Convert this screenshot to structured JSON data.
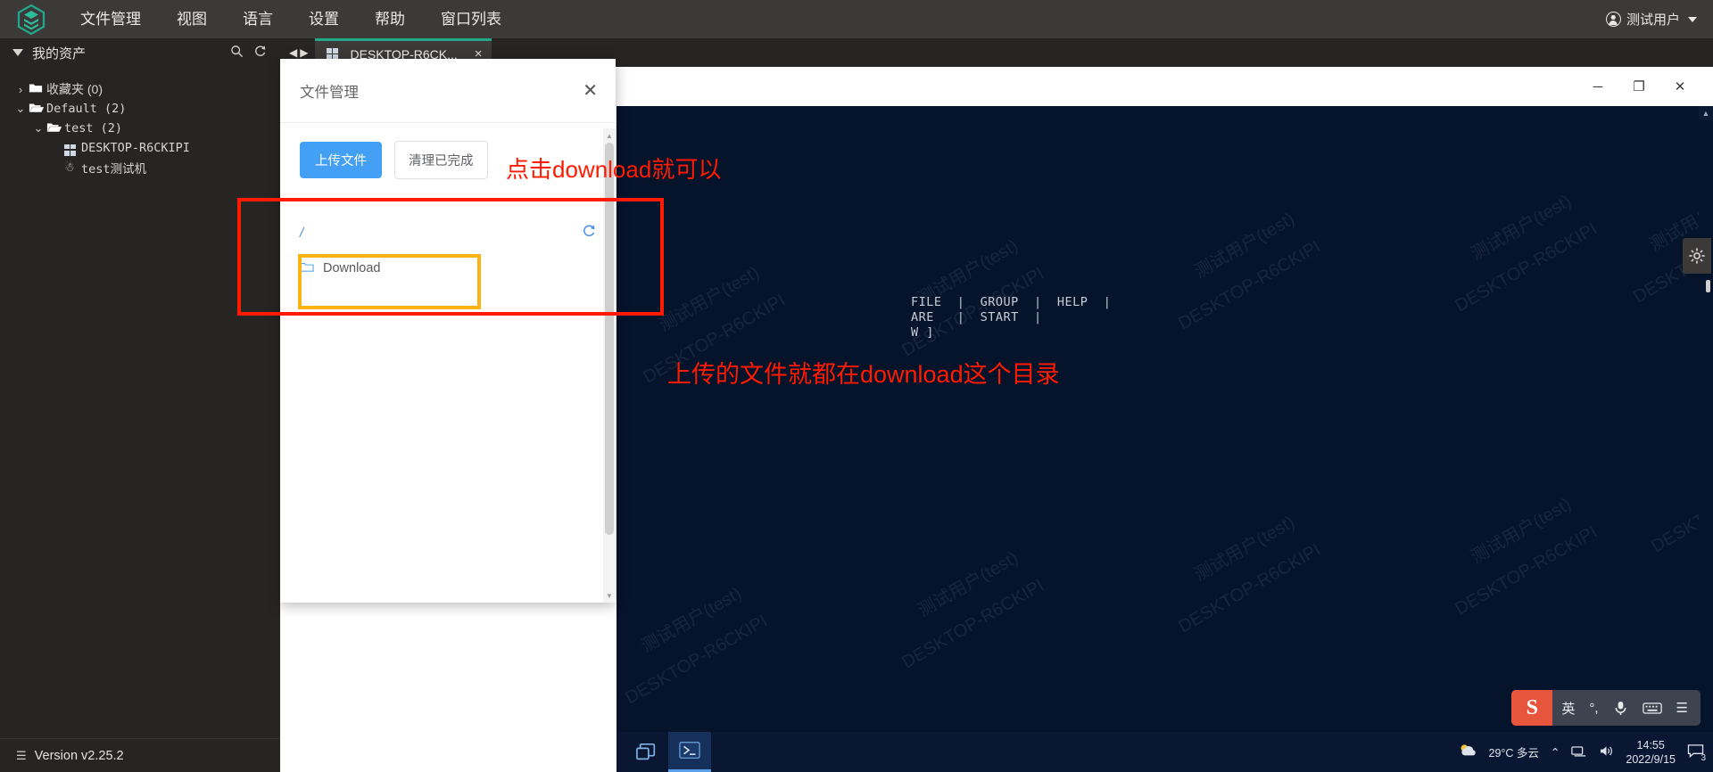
{
  "topbar": {
    "logo_name": "app-logo",
    "menu": [
      {
        "label": "文件管理"
      },
      {
        "label": "视图"
      },
      {
        "label": "语言"
      },
      {
        "label": "设置"
      },
      {
        "label": "帮助"
      },
      {
        "label": "窗口列表"
      }
    ],
    "user": "测试用户"
  },
  "sidebar": {
    "title": "我的资产",
    "search_icon": "search-icon",
    "refresh_icon": "refresh-icon",
    "tree": [
      {
        "label": "收藏夹 (0)",
        "chev": "›",
        "icon": "folder-closed-icon",
        "indent": 0,
        "type": "folder"
      },
      {
        "label": "Default (2)",
        "chev": "⌄",
        "icon": "folder-open-icon",
        "indent": 0,
        "type": "folder"
      },
      {
        "label": "test (2)",
        "chev": "⌄",
        "icon": "folder-open-icon",
        "indent": 1,
        "type": "folder"
      },
      {
        "label": "DESKTOP-R6CKIPI",
        "chev": "",
        "icon": "windows-icon",
        "indent": 2,
        "type": "windows"
      },
      {
        "label": "test测试机",
        "chev": "",
        "icon": "linux-icon",
        "indent": 2,
        "type": "linux"
      }
    ],
    "version": "Version v2.25.2",
    "version_icon": "list-icon"
  },
  "tabs": {
    "nav_prev": "◀",
    "nav_next": "▶",
    "items": [
      {
        "label": "DESKTOP-R6CK...",
        "icon": "windows-icon",
        "close": "×",
        "active": true
      }
    ]
  },
  "file_manager": {
    "title": "文件管理",
    "close_icon": "close-icon",
    "upload_button": "上传文件",
    "clear_button": "清理已完成",
    "path": "/",
    "refresh_icon": "refresh-icon",
    "items": [
      {
        "name": "Download",
        "icon": "folder-icon"
      }
    ]
  },
  "remote": {
    "window_controls": {
      "minimize": "─",
      "maximize": "❐",
      "close": "✕"
    },
    "watermark": [
      "测试用户(test)",
      "DESKTOP-R6CKIPI"
    ],
    "terminal_lines": [
      "FILE  |  GROUP  |  HELP  |",
      "ARE   |  START  |",
      "W ]"
    ],
    "gear_icon": "gear-icon",
    "taskbar": {
      "apps": [
        {
          "icon": "task-view-icon",
          "name": "task-view"
        },
        {
          "icon": "terminal-icon",
          "name": "powershell",
          "active": true
        }
      ],
      "weather": "29°C 多云",
      "weather_icon": "sun-cloud-icon",
      "chevron": "⌃",
      "network_icon": "network-icon",
      "volume_icon": "volume-icon",
      "time": "14:55",
      "date": "2022/9/15",
      "notification_icon": "notification-icon",
      "notification_count": "3"
    },
    "ime": {
      "logo": "S",
      "mode": "英",
      "punct": "°,",
      "mic_icon": "mic-icon",
      "keyboard_icon": "keyboard-icon",
      "menu_icon": "menu-icon"
    }
  },
  "annotations": {
    "red_box_name": "red-highlight-box",
    "orange_box_name": "orange-highlight-box",
    "text_top": "点击download就可以",
    "text_bottom": "上传的文件就都在download这个目录",
    "color_red": "#ff1a00",
    "color_orange": "#fbb213"
  }
}
